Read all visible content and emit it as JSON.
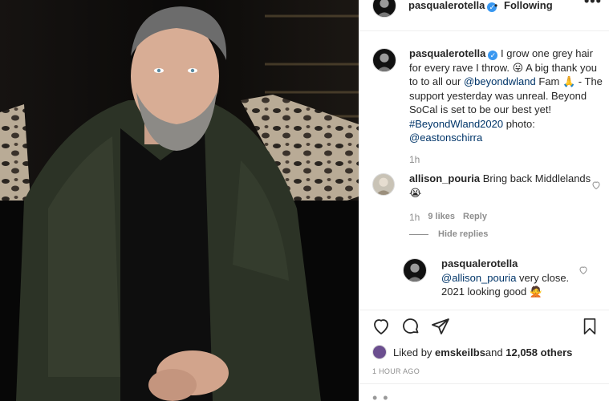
{
  "post": {
    "username": "pasqualerotella",
    "separator": "•",
    "follow_status": "Following",
    "more_label": "•••"
  },
  "caption": {
    "username": "pasqualerotella",
    "text_1": "I grow one grey hair for every rave I throw. ",
    "emoji_1": "😛",
    "text_2": " A big thank you to to all our ",
    "mention": "@beyondwland",
    "text_3": " Fam ",
    "emoji_2": "🙏",
    "text_4": " - The support yesterday was unreal. Beyond SoCal is set to be our best yet! ",
    "hashtag": "#BeyondWland2020",
    "text_5": " photo: ",
    "credit": "@eastonschirra",
    "time": "1h"
  },
  "comments": [
    {
      "username": "allison_pouria",
      "text": " Bring back Middlelands ",
      "emoji": "😭",
      "time": "1h",
      "likes": "9 likes",
      "reply_label": "Reply",
      "hide_replies": "Hide replies",
      "replies": [
        {
          "username": "pasqualerotella",
          "mention": "@allison_pouria",
          "text": " very close. 2021 looking good ",
          "emoji": "🙅"
        }
      ]
    }
  ],
  "likes": {
    "prefix": "Liked by ",
    "user": "emskeilbs",
    "middle": " and ",
    "others": "12,058 others"
  },
  "posted": "1 HOUR AGO",
  "icons": {
    "like": "heart-icon",
    "comment": "comment-icon",
    "share": "share-icon",
    "save": "bookmark-icon"
  },
  "colors": {
    "link": "#003569",
    "verified": "#3897f0",
    "meta": "#8e8e8e"
  }
}
